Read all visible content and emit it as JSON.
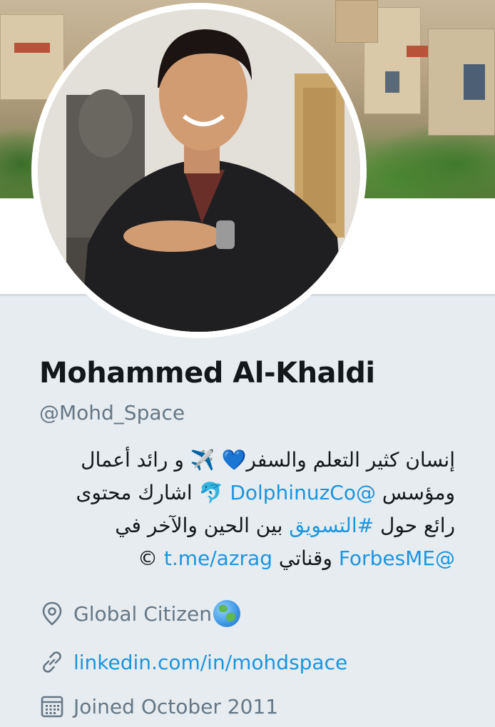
{
  "profile": {
    "display_name": "Mohammed Al-Khaldi",
    "handle": "@Mohd_Space"
  },
  "bio": {
    "line1_text": "إنسان كثير التعلم والسفر",
    "line1_emojis": "💙 ✈️",
    "line1_tail": " و رائد أعمال",
    "line2_text": "ومؤسس ",
    "line2_link": "@DolphinuzCo",
    "line2_emoji": " 🐬 ",
    "line2_tail": "اشارك محتوى",
    "line3_text": "رائع حول ",
    "line3_hashtag": "#التسويق",
    "line3_tail": " بين الحين والآخر في",
    "line4_link1": "@ForbesME",
    "line4_text": " وقناتي ",
    "line4_link2": "t.me/azrag",
    "line4_tail": " ©"
  },
  "meta": {
    "location": "Global Citizen",
    "location_emoji_icon": "globe-asia-emoji",
    "website": "linkedin.com/in/mohdspace",
    "joined": "Joined October 2011"
  },
  "icons": {
    "location": "location-pin-icon",
    "website": "link-icon",
    "joined": "calendar-icon"
  },
  "colors": {
    "text_primary": "#14171a",
    "text_secondary": "#657786",
    "link": "#1b95e0",
    "background": "#e6ecf0"
  }
}
